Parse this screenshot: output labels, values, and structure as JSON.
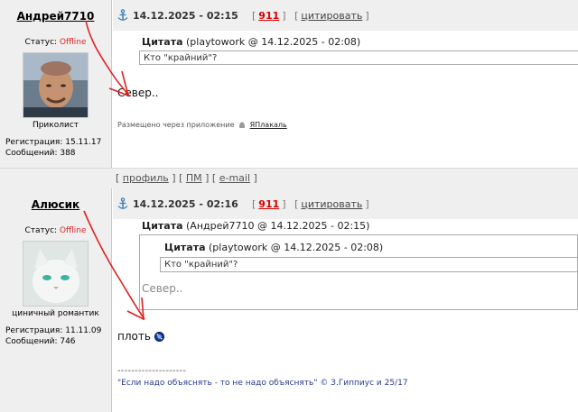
{
  "posts": [
    {
      "author": "Андрей7710",
      "status_label": "Статус:",
      "status_value": "Offline",
      "caption": "Приколист",
      "reg_label": "Регистрация: 15.11.17",
      "msgs_label": "Сообщений: 388",
      "date": "14.12.2025 - 02:15",
      "msg_number": "911",
      "quote_action": "цитировать",
      "quote_title": "Цитата",
      "quote_meta": "(playtowork @ 14.12.2025 - 02:08)",
      "quote_text": "Кто \"крайний\"?",
      "body": "Север..",
      "app_note": "Размещено через приложение",
      "app_name": "ЯПлакаль"
    },
    {
      "author": "Алюсик",
      "status_label": "Статус:",
      "status_value": "Offline",
      "caption": "циничный романтик",
      "reg_label": "Регистрация: 11.11.09",
      "msgs_label": "Сообщений: 746",
      "date": "14.12.2025 - 02:16",
      "msg_number": "911",
      "quote_action": "цитировать",
      "quote_title": "Цитата",
      "quote_meta": "(Андрей7710 @ 14.12.2025 - 02:15)",
      "inner_quote_title": "Цитата",
      "inner_quote_meta": "(playtowork @ 14.12.2025 - 02:08)",
      "inner_quote_text": "Кто \"крайний\"?",
      "outer_quote_text": "Север..",
      "body": "плоть",
      "separator": "--------------------",
      "signature": "\"Если надо объяснять - то не надо объяснять\" © З.Гиппиус и 25/17"
    }
  ],
  "footer_links": {
    "profile": "профиль",
    "pm": "ПМ",
    "email": "e-mail"
  },
  "colors": {
    "offline": "#dd2222",
    "counter": "#dd0000",
    "annotation": "#e02020",
    "signature": "#2b3a8f"
  }
}
